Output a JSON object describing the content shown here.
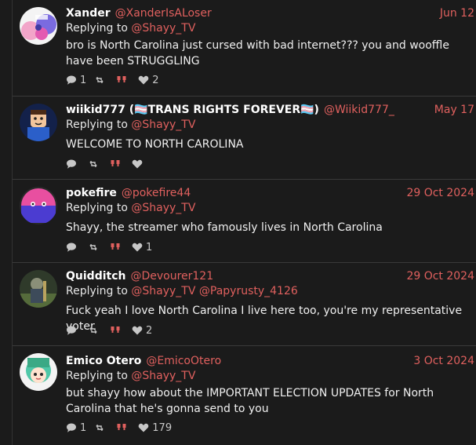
{
  "colors": {
    "background": "#1b1b1b",
    "accent": "#e0605e",
    "divider": "#3a3a3a"
  },
  "replying_label": "Replying to",
  "posts": [
    {
      "name": "Xander",
      "handle": "@XanderIsALoser",
      "date": "Jun 12",
      "reply_to": [
        "@Shayy_TV"
      ],
      "text": "bro is North Carolina just cursed with bad internet??? you and wooffle have been STRUGGLING",
      "replies": "1",
      "retweets": "",
      "quotes": "",
      "likes": "2",
      "avatar_icon": "avatar-xander"
    },
    {
      "name": "wiikid777 (🏳️‍⚧️TRANS RIGHTS FOREVER🏳️‍⚧️)",
      "handle": "@Wiikid777_",
      "date": "May 17",
      "reply_to": [
        "@Shayy_TV"
      ],
      "text": "WELCOME TO NORTH CAROLINA",
      "replies": "",
      "retweets": "",
      "quotes": "",
      "likes": "",
      "avatar_icon": "avatar-wiikid777"
    },
    {
      "name": "pokefire",
      "handle": "@pokefire44",
      "date": "29 Oct 2024",
      "reply_to": [
        "@Shayy_TV"
      ],
      "text": "Shayy, the streamer who famously lives in North Carolina",
      "replies": "",
      "retweets": "",
      "quotes": "",
      "likes": "1",
      "avatar_icon": "avatar-pokefire"
    },
    {
      "name": "Quidditch",
      "handle": "@Devourer121",
      "date": "29 Oct 2024",
      "reply_to": [
        "@Shayy_TV",
        "@Papyrusty_4126"
      ],
      "text": "Fuck yeah I love North Carolina I live here too, you're my representative voter",
      "replies": "",
      "retweets": "",
      "quotes": "",
      "likes": "2",
      "avatar_icon": "avatar-quidditch"
    },
    {
      "name": "Emico Otero",
      "handle": "@EmicoOtero",
      "date": "3 Oct 2024",
      "reply_to": [
        "@Shayy_TV"
      ],
      "text": "but shayy how about the IMPORTANT ELECTION UPDATES for North Carolina that he's gonna send to you",
      "replies": "1",
      "retweets": "",
      "quotes": "",
      "likes": "179",
      "avatar_icon": "avatar-emico"
    }
  ]
}
